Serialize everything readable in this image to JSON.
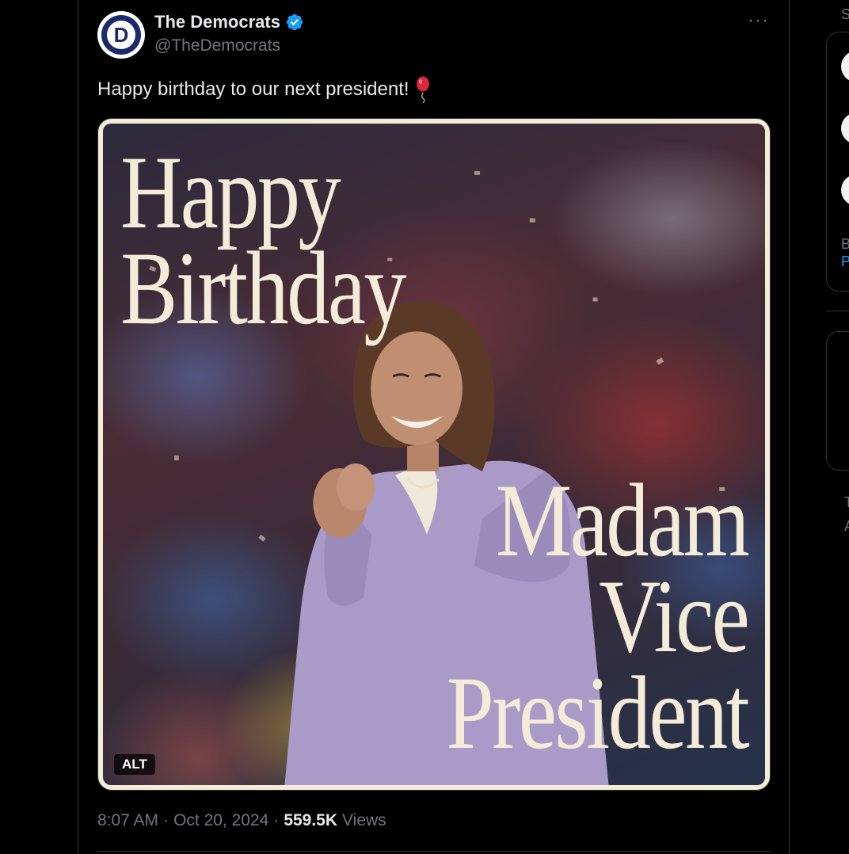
{
  "tweet": {
    "display_name": "The Democrats",
    "handle": "@TheDemocrats",
    "avatar_letter": "D",
    "text": "Happy birthday to our next president!",
    "emoji_icon": "balloon-icon",
    "more_label": "···",
    "media": {
      "headline_top": [
        "Happy",
        "Birthday"
      ],
      "headline_bottom": [
        "Madam",
        "Vice",
        "President"
      ],
      "alt_label": "ALT"
    },
    "time": "8:07 AM",
    "separator": "·",
    "date": "Oct 20, 2024",
    "views_count": "559.5K",
    "views_label": "Views"
  },
  "sidebar": {
    "letters": [
      "S",
      "B",
      "P",
      "T",
      "A"
    ]
  },
  "colors": {
    "background": "#000000",
    "verified": "#1d9bf0",
    "link": "#1d9bf0",
    "muted": "#71767b",
    "brand_navy": "#1b2a6b"
  }
}
